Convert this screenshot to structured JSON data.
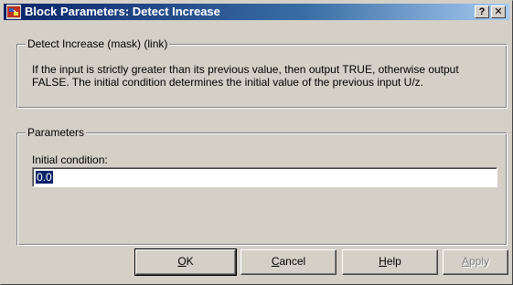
{
  "window": {
    "title": "Block Parameters: Detect Increase",
    "help_button": "?",
    "close_button": "✕"
  },
  "description_group": {
    "label": "Detect Increase (mask) (link)",
    "text": "If the input is strictly greater than its previous value, then output TRUE, otherwise output FALSE.  The initial condition determines the initial value of the previous input U/z."
  },
  "parameters_group": {
    "label": "Parameters",
    "initial_condition_label": "Initial condition:",
    "initial_condition_value": "0.0"
  },
  "buttons": {
    "ok": {
      "mnemonic": "O",
      "rest": "K"
    },
    "cancel": {
      "mnemonic": "C",
      "rest": "ancel"
    },
    "help": {
      "mnemonic": "H",
      "rest": "elp"
    },
    "apply": {
      "mnemonic": "A",
      "rest": "pply",
      "enabled": false
    }
  },
  "icons": [
    "simulink-block-icon",
    "help-icon",
    "close-icon"
  ],
  "colors": {
    "title_bar_start": "#0a246a",
    "title_bar_end": "#a6caf0",
    "face": "#d4d0c8",
    "selection": "#0a246a"
  }
}
